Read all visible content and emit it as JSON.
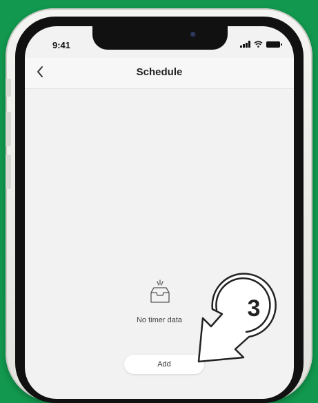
{
  "status_bar": {
    "time": "9:41"
  },
  "header": {
    "back_icon": "chevron-left-icon",
    "title": "Schedule"
  },
  "empty_state": {
    "icon": "empty-inbox-icon",
    "message": "No timer data"
  },
  "actions": {
    "add_label": "Add"
  },
  "callout": {
    "number": "3"
  },
  "colors": {
    "background": "#12994f",
    "screen": "#f2f2f2",
    "accent_dark": "#222222"
  }
}
